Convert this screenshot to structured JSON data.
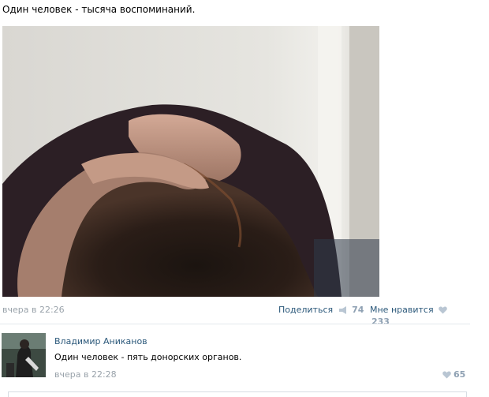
{
  "post": {
    "text": "Один человек - тысяча воспоминаний.",
    "time": "вчера в 22:26",
    "share_label": "Поделиться",
    "share_count": "74",
    "like_label": "Мне нравится",
    "like_count": "233"
  },
  "comment": {
    "author": "Владимир Аниканов",
    "text": "Один человек - пять донорских органов.",
    "time": "вчера в 22:28",
    "like_count": "65"
  },
  "icons": {
    "share": "megaphone-icon",
    "like": "heart-icon"
  },
  "colors": {
    "link": "#2b587a",
    "muted": "#9aa3ab",
    "count": "#8fa1b3"
  }
}
